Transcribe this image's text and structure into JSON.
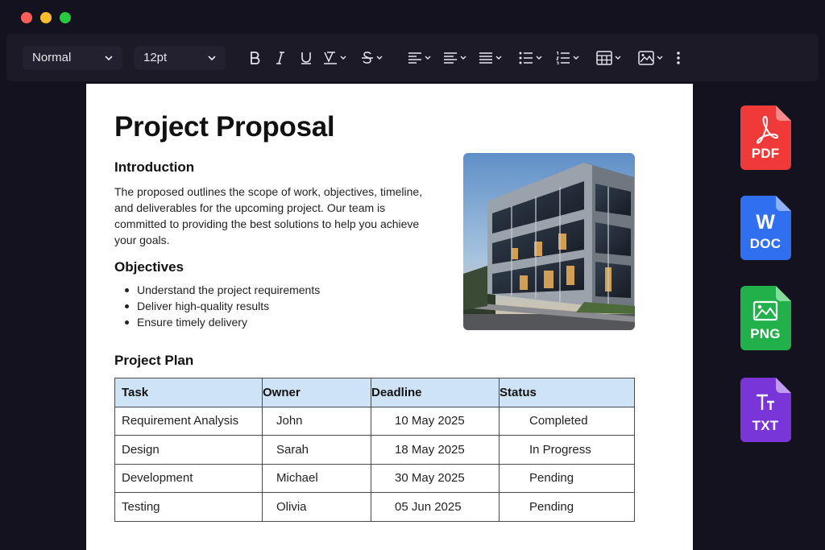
{
  "toolbar": {
    "paragraph_style": "Normal",
    "font_size": "12pt"
  },
  "document": {
    "title": "Project Proposal",
    "introduction": {
      "heading": "Introduction",
      "body": "The proposed outlines the scope of work, objectives, timeline, and deliverables for the upcoming project. Our team is committed to providing the best solutions to help you achieve your goals."
    },
    "objectives": {
      "heading": "Objectives",
      "items": [
        "Understand the project requirements",
        "Deliver high-quality results",
        "Ensure timely delivery"
      ]
    },
    "plan": {
      "heading": "Project Plan",
      "columns": [
        "Task",
        "Owner",
        "Deadline",
        "Status"
      ],
      "rows": [
        [
          "Requirement Analysis",
          "John",
          "10 May 2025",
          "Completed"
        ],
        [
          "Design",
          "Sarah",
          "18 May 2025",
          "In Progress"
        ],
        [
          "Development",
          "Michael",
          "30 May 2025",
          "Pending"
        ],
        [
          "Testing",
          "Olivia",
          "05 Jun 2025",
          "Pending"
        ]
      ]
    }
  },
  "export_formats": [
    {
      "label": "PDF",
      "icon": "pdf-file-icon",
      "color": "#f03a3a"
    },
    {
      "label": "DOC",
      "icon": "word-file-icon",
      "color": "#2f6ff0"
    },
    {
      "label": "PNG",
      "icon": "image-file-icon",
      "color": "#22b04a"
    },
    {
      "label": "TXT",
      "icon": "text-file-icon",
      "color": "#7a35d8"
    }
  ]
}
